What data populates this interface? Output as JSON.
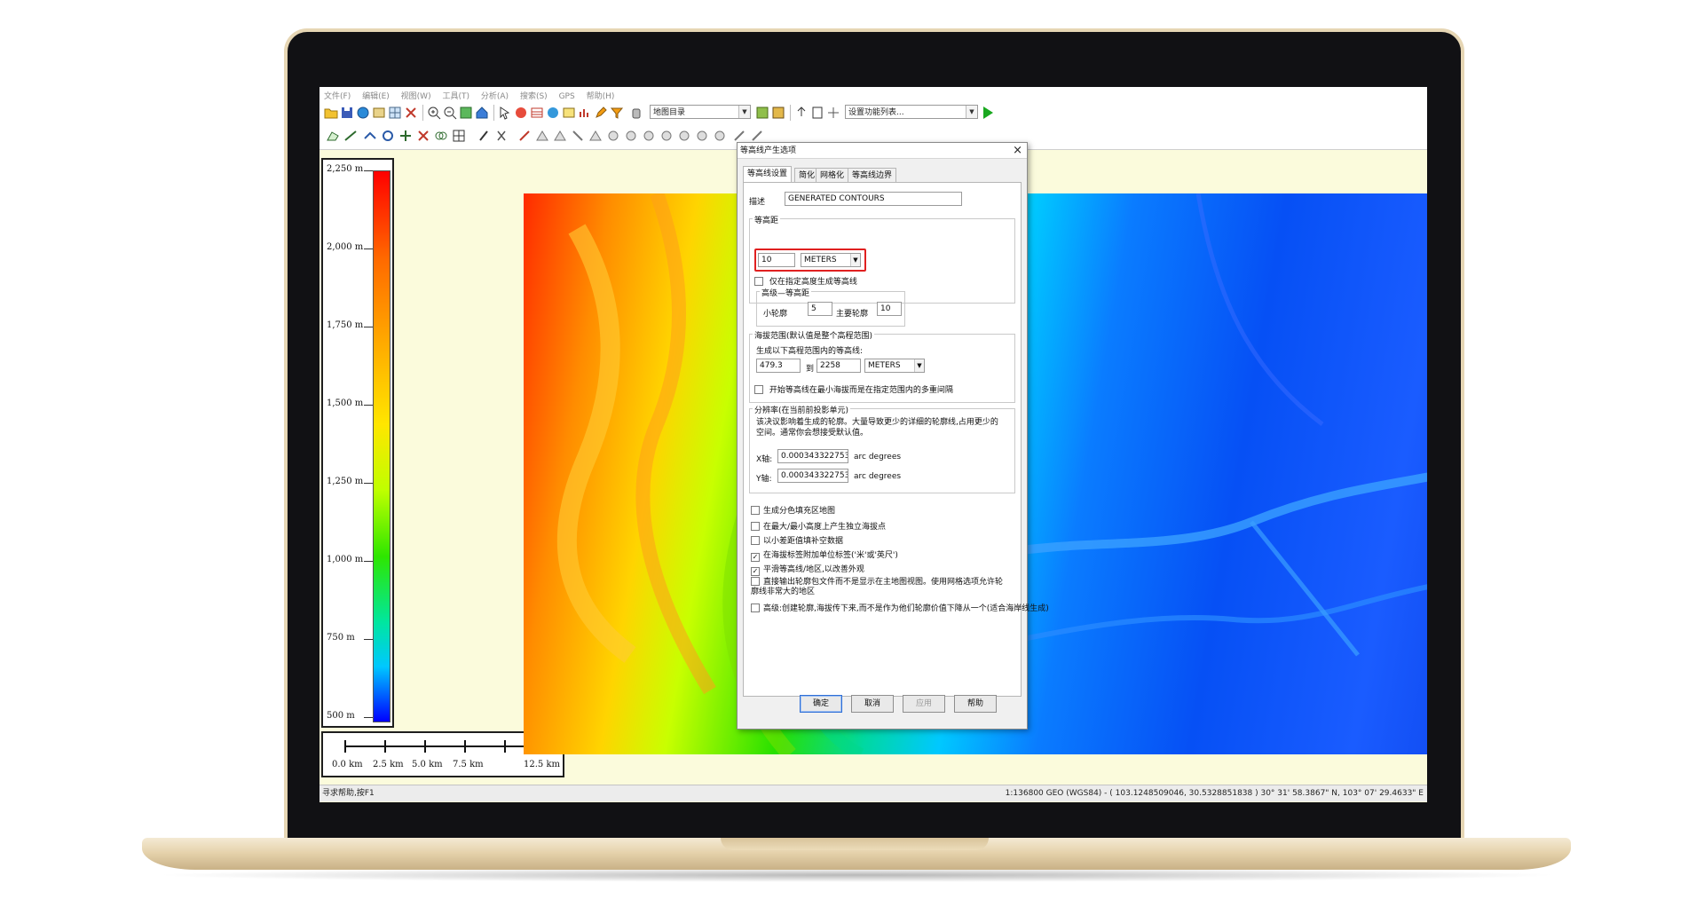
{
  "menubar": [
    "文件(F)",
    "编辑(E)",
    "视图(W)",
    "工具(T)",
    "分析(A)",
    "搜索(S)",
    "GPS",
    "帮助(H)"
  ],
  "toolbar": {
    "map_combo": "地图目录",
    "config_combo": "设置功能列表..."
  },
  "legend": {
    "labels": [
      "2,250 m",
      "2,000 m",
      "1,750 m",
      "1,500 m",
      "1,250 m",
      "1,000 m",
      "750 m",
      "500 m"
    ]
  },
  "scale": {
    "labels": [
      "0.0 km",
      "2.5 km",
      "5.0 km",
      "7.5 km",
      "12.5 km"
    ]
  },
  "status": {
    "left": "寻求帮助,按F1",
    "right": "1:136800  GEO (WGS84) - ( 103.1248509046, 30.5328851838 )  30° 31' 58.3867\" N, 103° 07' 29.4633\" E"
  },
  "dialog": {
    "title": "等高线产生选项",
    "close": "×",
    "tabs": [
      "等高线设置",
      "简化",
      "网格化",
      "等高线边界"
    ],
    "description_label": "描述",
    "description_value": "GENERATED CONTOURS",
    "interval_group": "等高距",
    "interval_value": "10",
    "interval_unit": "METERS",
    "only_specified_label": "仅在指定高度生成等高线",
    "advanced_group": "高级—等高距",
    "minor_label": "小轮廓",
    "minor_value": "5",
    "major_label": "主要轮廓",
    "major_value": "10",
    "range_group": "海拔范围(默认值是整个高程范围)",
    "range_desc": "生成以下高程范围内的等高线:",
    "range_from": "479.3",
    "range_to_label": "到",
    "range_to": "2258",
    "range_unit": "METERS",
    "range_check": "开始等高线在最小海拔而是在指定范围内的多重间隔",
    "resolution_group": "分辨率(在当前前投影单元)",
    "resolution_desc": "该决议影响着生成的轮廓。大量导致更少的详细的轮廓线,占用更少的空间。通常你会想接受默认值。",
    "x_label": "X轴:",
    "x_value": "0.00034332275390625",
    "x_unit": "arc degrees",
    "y_label": "Y轴:",
    "y_value": "0.00034332275390625",
    "y_unit": "arc degrees",
    "checks": [
      {
        "label": "生成分色填充区地图",
        "checked": false
      },
      {
        "label": "在最大/最小高度上产生独立海拔点",
        "checked": false
      },
      {
        "label": "以小差距值填补空数据",
        "checked": false
      },
      {
        "label": "在海拔标签附加单位标签('米'或'英尺')",
        "checked": true
      },
      {
        "label": "平滑等高线/地区,以改善外观",
        "checked": true
      },
      {
        "label": "直接输出轮廓包文件而不是显示在主地图视图。使用网格选项允许轮廓线非常大的地区",
        "checked": false
      },
      {
        "label": "高级:创建轮廓,海拔传下来,而不是作为他们轮廓价值下降从一个(适合海岸线生成)",
        "checked": false
      }
    ],
    "buttons": {
      "ok": "确定",
      "cancel": "取消",
      "apply": "应用",
      "help": "帮助"
    }
  },
  "colors": {
    "highlight": "#e02020",
    "frame": "#e6d6b4",
    "map_bg": "#fbfbdc"
  }
}
